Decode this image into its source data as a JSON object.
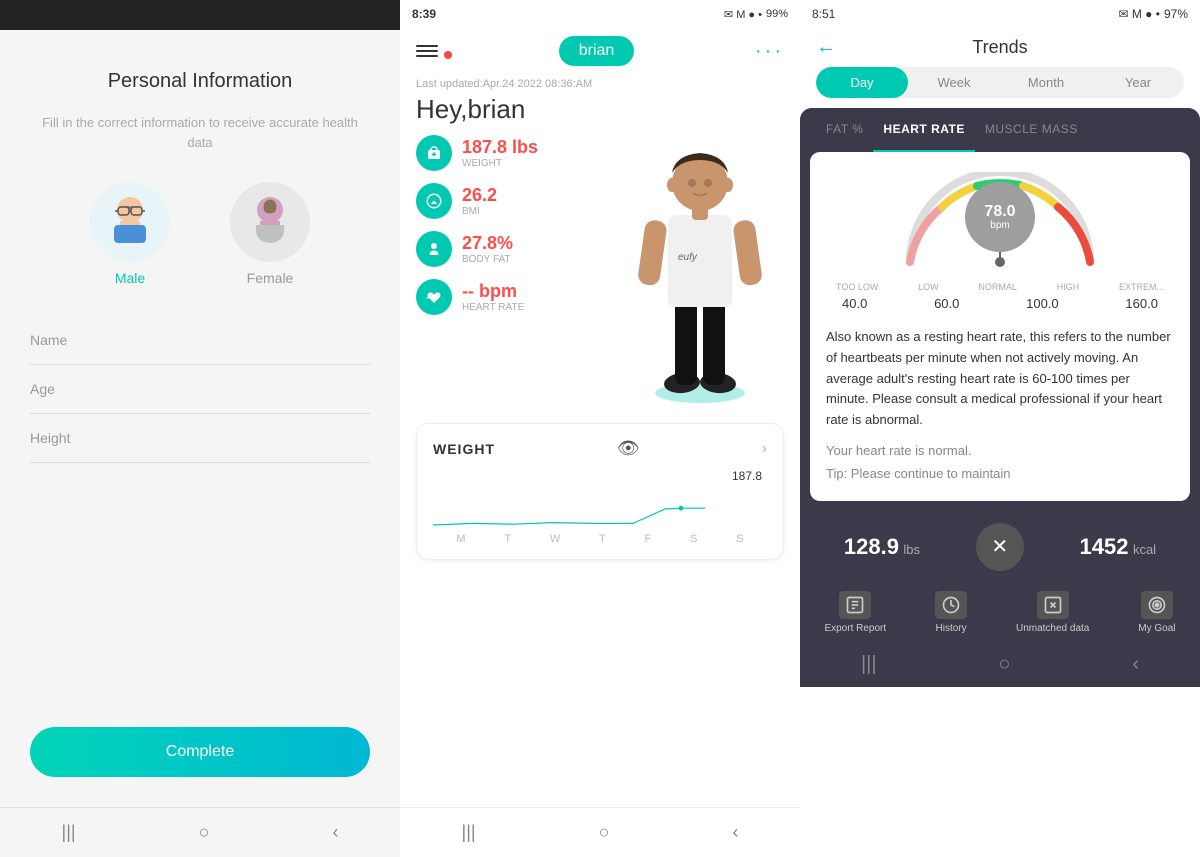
{
  "panel1": {
    "title": "Personal Information",
    "subtitle": "Fill in the correct information to receive accurate health data",
    "gender": {
      "male_label": "Male",
      "female_label": "Female"
    },
    "fields": {
      "name": "Name",
      "age": "Age",
      "height": "Height"
    },
    "complete_button": "Complete",
    "nav": {
      "back": "|||",
      "home": "○",
      "recent": "‹"
    }
  },
  "panel2": {
    "status_bar": {
      "time": "8:39",
      "icons": "✉ M ● •",
      "wifi": "WiFi",
      "signal": "●●●",
      "battery": "99%"
    },
    "last_updated": "Last updated:Apr.24 2022 08:36:AM",
    "greeting": "Hey,brian",
    "user_name": "brian",
    "metrics": {
      "weight": {
        "value": "187.8 lbs",
        "label": "WEIGHT"
      },
      "bmi": {
        "value": "26.2",
        "label": "BMI"
      },
      "body_fat": {
        "value": "27.8%",
        "label": "Body Fat"
      },
      "heart_rate": {
        "value": "-- bpm",
        "label": "Heart Rate"
      }
    },
    "weight_card": {
      "title": "WEIGHT",
      "chart_value": "187.8",
      "days": [
        "M",
        "T",
        "W",
        "T",
        "F",
        "S",
        "S"
      ]
    },
    "eufy_label": "eufy",
    "nav": {
      "back": "|||",
      "home": "○",
      "recent": "‹"
    }
  },
  "panel3": {
    "status_bar": {
      "time": "8:51",
      "icons": "✉ M ● •",
      "wifi": "WiFi",
      "signal": "●●●",
      "battery": "97%"
    },
    "title": "Trends",
    "time_tabs": [
      "Day",
      "Week",
      "Month",
      "Year"
    ],
    "active_time_tab": 0,
    "metric_tabs": [
      "FAT %",
      "HEART RATE",
      "MUSCLE MASS"
    ],
    "active_metric_tab": 1,
    "heart_rate": {
      "value": "78.0",
      "unit": "bpm",
      "gauge_labels": [
        "TOO LOW",
        "LOW",
        "NORMAL",
        "HIGH",
        "EXTREM..."
      ],
      "gauge_numbers": [
        "40.0",
        "60.0",
        "100.0",
        "160.0"
      ],
      "description": "Also known as a resting heart rate, this refers to the number of heartbeats per minute when not actively moving. An average adult's resting heart rate is 60-100 times per minute. Please consult a medical professional if your heart rate is abnormal.",
      "status": "Your heart rate is normal.",
      "tip": "Tip: Please continue to maintain"
    },
    "bottom_stats": {
      "weight_value": "128.9",
      "weight_unit": "lbs",
      "calories_value": "1452",
      "calories_unit": "kcal"
    },
    "bottom_nav": {
      "export_report": "Export Report",
      "history": "History",
      "unmatched_data": "Unmatched data",
      "my_goal": "My Goal"
    },
    "nav": {
      "back": "|||",
      "home": "○",
      "recent": "‹"
    }
  }
}
